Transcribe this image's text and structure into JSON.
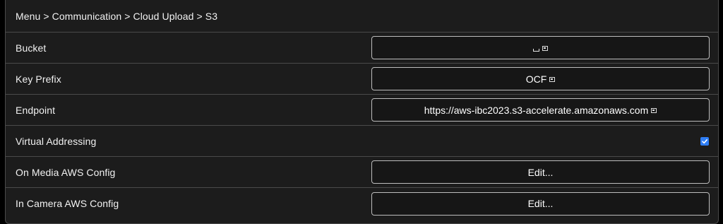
{
  "breadcrumb": "Menu > Communication > Cloud Upload > S3",
  "rows": {
    "bucket": {
      "label": "Bucket",
      "value": "",
      "has_external_icon": true
    },
    "key_prefix": {
      "label": "Key Prefix",
      "value": "OCF",
      "has_external_icon": true
    },
    "endpoint": {
      "label": "Endpoint",
      "value": "https://aws-ibc2023.s3-accelerate.amazonaws.com",
      "has_external_icon": true
    },
    "virtual_addressing": {
      "label": "Virtual Addressing",
      "checked": true
    },
    "on_media_aws_config": {
      "label": "On Media AWS Config",
      "button_label": "Edit..."
    },
    "in_camera_aws_config": {
      "label": "In Camera AWS Config",
      "button_label": "Edit..."
    }
  },
  "colors": {
    "panel_bg": "#1c1c1c",
    "border": "#4a4a4a",
    "checkbox_accent": "#2f7ef5"
  }
}
